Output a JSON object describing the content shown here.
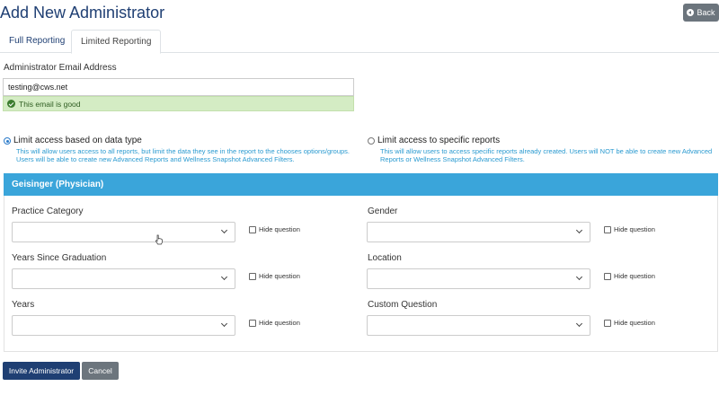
{
  "header": {
    "title": "Add New Administrator",
    "back_label": "Back"
  },
  "tabs": [
    {
      "label": "Full Reporting",
      "active": false
    },
    {
      "label": "Limited Reporting",
      "active": true
    }
  ],
  "email": {
    "label": "Administrator Email Address",
    "value": "testing@cws.net",
    "validation": "This email is good"
  },
  "access_options": [
    {
      "label": "Limit access based on data type",
      "description": "This will allow users access to all reports, but limit the data they see in the report to the chooses options/groups. Users will be able to create new Advanced Reports and Wellness Snapshot Advanced Filters.",
      "selected": true
    },
    {
      "label": "Limit access to specific reports",
      "description": "This will allow users to access specific reports already created. Users will NOT be able to create new Advanced Reports or Wellness Snapshot Advanced Filters.",
      "selected": false
    }
  ],
  "group": {
    "name": "Geisinger (Physician)",
    "fields": [
      {
        "label": "Practice Category",
        "value": "",
        "hide_label": "Hide question",
        "hidden": false
      },
      {
        "label": "Gender",
        "value": "",
        "hide_label": "Hide question",
        "hidden": false
      },
      {
        "label": "Years Since Graduation",
        "value": "",
        "hide_label": "Hide question",
        "hidden": false
      },
      {
        "label": "Location",
        "value": "",
        "hide_label": "Hide question",
        "hidden": false
      },
      {
        "label": "Years",
        "value": "",
        "hide_label": "Hide question",
        "hidden": false
      },
      {
        "label": "Custom Question",
        "value": "",
        "hide_label": "Hide question",
        "hidden": false
      }
    ]
  },
  "actions": {
    "invite_label": "Invite Administrator",
    "cancel_label": "Cancel"
  },
  "colors": {
    "title": "#1f3f73",
    "primary_button": "#1f3f73",
    "group_header": "#3aa5da",
    "valid_bg": "#d4ecc4",
    "description_text": "#2a9ad0"
  }
}
